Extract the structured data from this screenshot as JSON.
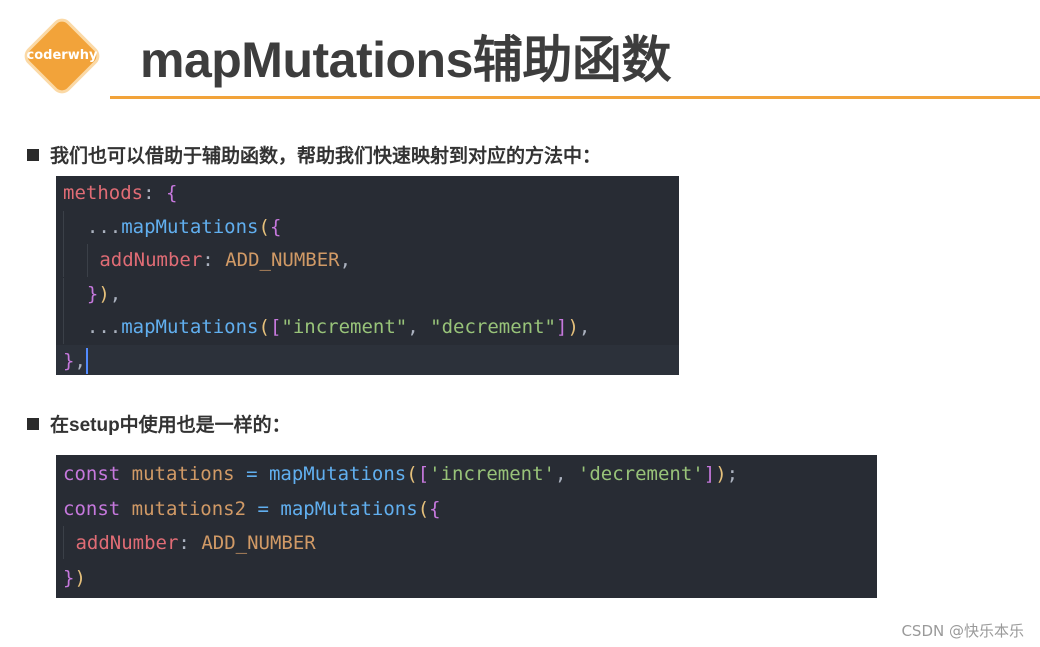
{
  "logo": {
    "text": "coderwhy",
    "color": "#f2a33a"
  },
  "title": "mapMutations辅助函数",
  "accent_color": "#f2a33a",
  "bullets": [
    "我们也可以借助于辅助函数，帮助我们快速映射到对应的方法中：",
    "在setup中使用也是一样的："
  ],
  "code1": {
    "l1": {
      "a": "methods",
      "b": ":",
      "c": "{"
    },
    "l2": {
      "a": "...",
      "b": "mapMutations",
      "c": "(",
      "d": "{"
    },
    "l3": {
      "a": "addNumber",
      "b": ":",
      "c": "ADD_NUMBER",
      "d": ","
    },
    "l4": {
      "a": "}",
      "b": ")",
      "c": ","
    },
    "l5": {
      "a": "...",
      "b": "mapMutations",
      "c": "(",
      "d": "[",
      "e": "\"increment\"",
      "f": ",",
      "g": "\"decrement\"",
      "h": "]",
      "i": ")",
      "j": ","
    },
    "l6": {
      "a": "}",
      "b": ","
    }
  },
  "code2": {
    "l1": {
      "a": "const",
      "b": "mutations",
      "c": "=",
      "d": "mapMutations",
      "e": "(",
      "f": "[",
      "g": "'increment'",
      "h": ",",
      "i": "'decrement'",
      "j": "]",
      "k": ")",
      "l": ";"
    },
    "l2": {
      "a": "const",
      "b": "mutations2",
      "c": "=",
      "d": "mapMutations",
      "e": "(",
      "f": "{"
    },
    "l3": {
      "a": "addNumber",
      "b": ":",
      "c": "ADD_NUMBER"
    },
    "l4": {
      "a": "}",
      "b": ")"
    }
  },
  "watermark": "CSDN @快乐本乐"
}
